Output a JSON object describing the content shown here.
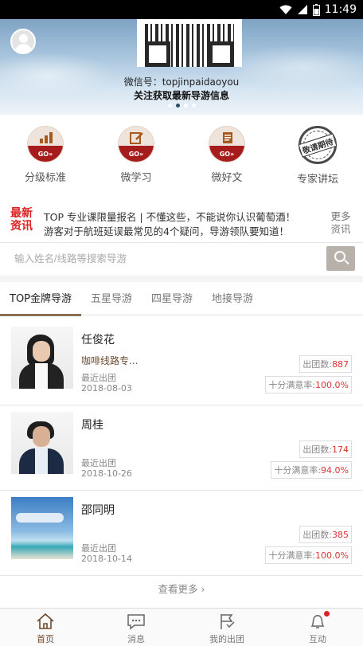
{
  "status_bar": {
    "time": "11:49"
  },
  "banner": {
    "wechat_id": "微信号：topjinpaidaoyou",
    "follow_text": "关注获取最新导游信息"
  },
  "categories": [
    {
      "label": "分级标准",
      "go": "GO»",
      "icon": "bar-chart-icon"
    },
    {
      "label": "微学习",
      "go": "GO»",
      "icon": "edit-icon"
    },
    {
      "label": "微好文",
      "go": "GO»",
      "icon": "document-icon"
    },
    {
      "label": "专家讲坛",
      "stamp": "敬请期待",
      "icon": "stamp-icon"
    }
  ],
  "news": {
    "badge_line1": "最新",
    "badge_line2": "资讯",
    "line1": "TOP 专业课限量报名 | 不懂这些，不能说你认识葡萄酒！",
    "line2": "游客对于航班延误最常见的4个疑问，导游领队要知道！",
    "more_line1": "更多",
    "more_line2": "资讯"
  },
  "search": {
    "placeholder": "输入姓名/线路等搜索导游"
  },
  "tabs": [
    {
      "label": "TOP金牌导游",
      "active": true
    },
    {
      "label": "五星导游",
      "active": false
    },
    {
      "label": "四星导游",
      "active": false
    },
    {
      "label": "地接导游",
      "active": false
    }
  ],
  "guides": [
    {
      "name": "任俊花",
      "route": "咖啡线路专...",
      "recent_label": "最近出团",
      "date": "2018-08-03",
      "count_label": "出团数:",
      "count": "887",
      "sat_label": "十分满意率:",
      "sat": "100.0%"
    },
    {
      "name": "周桂",
      "route": "",
      "recent_label": "最近出团",
      "date": "2018-10-26",
      "count_label": "出团数:",
      "count": "174",
      "sat_label": "十分满意率:",
      "sat": "94.0%"
    },
    {
      "name": "邵同明",
      "route": "",
      "recent_label": "最近出团",
      "date": "2018-10-14",
      "count_label": "出团数:",
      "count": "385",
      "sat_label": "十分满意率:",
      "sat": "100.0%"
    }
  ],
  "more_label": "查看更多",
  "nav": [
    {
      "label": "首页",
      "icon": "home-icon",
      "active": true
    },
    {
      "label": "消息",
      "icon": "message-icon",
      "active": false
    },
    {
      "label": "我的出团",
      "icon": "flag-icon",
      "active": false
    },
    {
      "label": "互动",
      "icon": "bell-icon",
      "active": false
    }
  ],
  "colors": {
    "accent": "#6d4a2e",
    "go_red": "#a61b1b",
    "news_red": "#d22222",
    "tab_underline": "#8a6f52"
  }
}
